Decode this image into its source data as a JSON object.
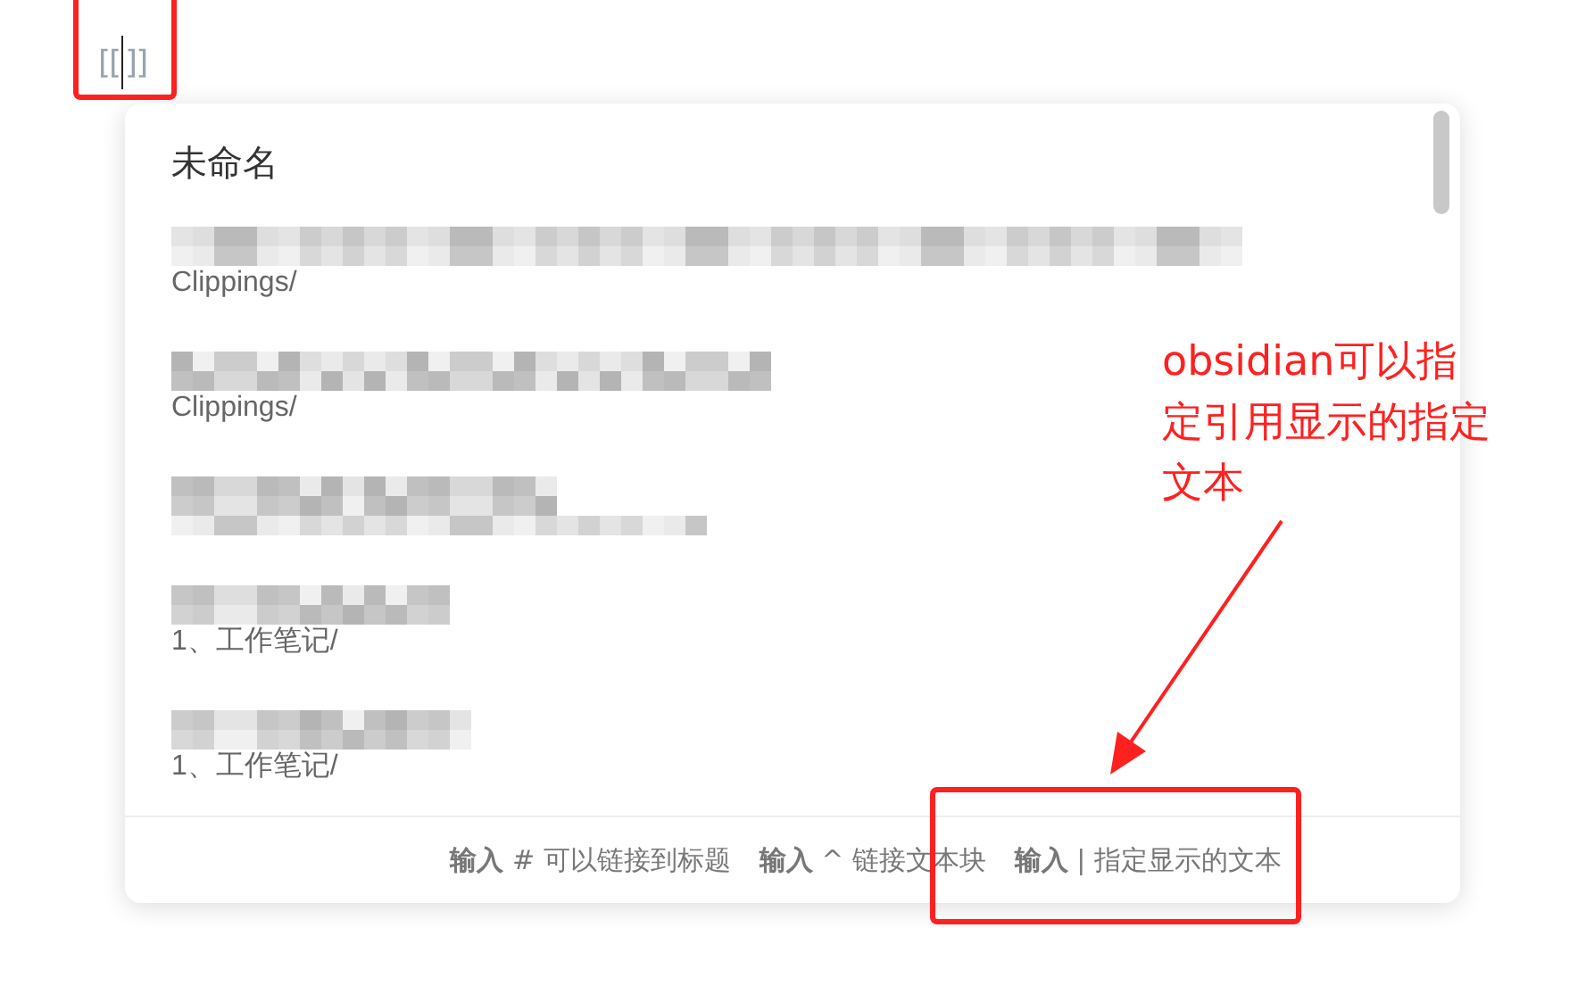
{
  "editor": {
    "before_cursor": "[[",
    "after_cursor": "]]"
  },
  "suggestions": {
    "title": "未命名",
    "items": [
      {
        "kind": "note",
        "path": "Clippings/"
      },
      {
        "kind": "note",
        "path": "Clippings/"
      },
      {
        "kind": "blurred"
      },
      {
        "kind": "note",
        "path": "1、工作笔记/"
      },
      {
        "kind": "note",
        "path": "1、工作笔记/"
      }
    ]
  },
  "footer_hints": [
    "**输入** # 可以链接到标题",
    "**输入** ^ 链接文本块",
    "**输入** | 指定显示的文本"
  ],
  "annotation": {
    "text": "obsidian可以指定引用显示的指定文本"
  }
}
